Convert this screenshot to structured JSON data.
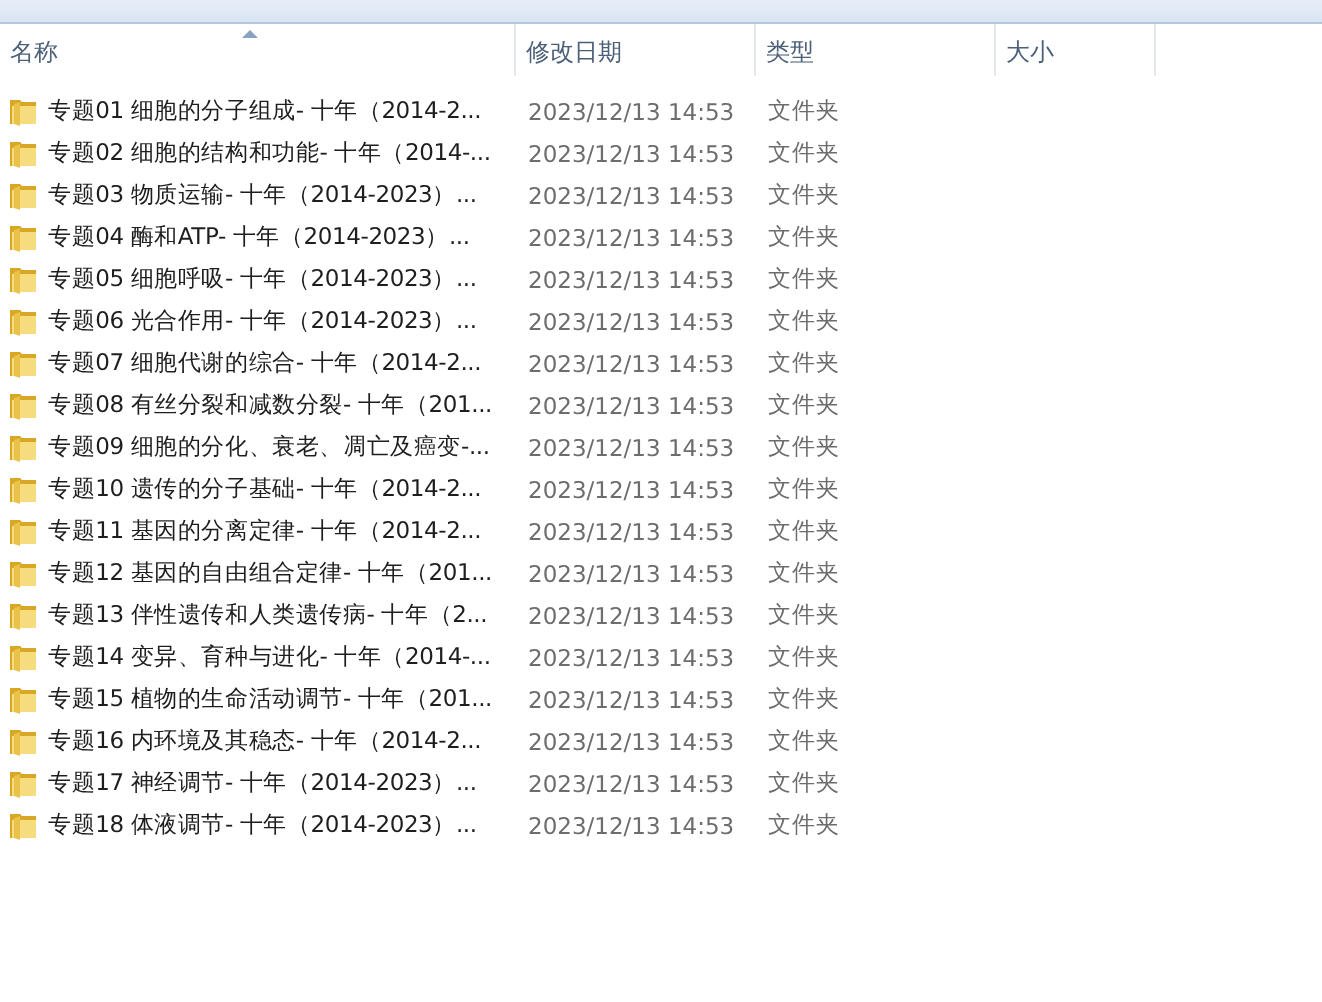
{
  "columns": [
    {
      "label": "名称",
      "sorted": true
    },
    {
      "label": "修改日期",
      "sorted": false
    },
    {
      "label": "类型",
      "sorted": false
    },
    {
      "label": "大小",
      "sorted": false
    }
  ],
  "rows": [
    {
      "name": "专题01 细胞的分子组成- 十年（2014-2...",
      "modified": "2023/12/13 14:53",
      "type": "文件夹"
    },
    {
      "name": "专题02 细胞的结构和功能- 十年（2014-...",
      "modified": "2023/12/13 14:53",
      "type": "文件夹"
    },
    {
      "name": "专题03 物质运输- 十年（2014-2023）...",
      "modified": "2023/12/13 14:53",
      "type": "文件夹"
    },
    {
      "name": "专题04 酶和ATP- 十年（2014-2023）...",
      "modified": "2023/12/13 14:53",
      "type": "文件夹"
    },
    {
      "name": "专题05 细胞呼吸- 十年（2014-2023）...",
      "modified": "2023/12/13 14:53",
      "type": "文件夹"
    },
    {
      "name": "专题06 光合作用- 十年（2014-2023）...",
      "modified": "2023/12/13 14:53",
      "type": "文件夹"
    },
    {
      "name": "专题07 细胞代谢的综合- 十年（2014-2...",
      "modified": "2023/12/13 14:53",
      "type": "文件夹"
    },
    {
      "name": "专题08 有丝分裂和减数分裂- 十年（201...",
      "modified": "2023/12/13 14:53",
      "type": "文件夹"
    },
    {
      "name": "专题09 细胞的分化、衰老、凋亡及癌变-...",
      "modified": "2023/12/13 14:53",
      "type": "文件夹"
    },
    {
      "name": "专题10 遗传的分子基础- 十年（2014-2...",
      "modified": "2023/12/13 14:53",
      "type": "文件夹"
    },
    {
      "name": "专题11 基因的分离定律- 十年（2014-2...",
      "modified": "2023/12/13 14:53",
      "type": "文件夹"
    },
    {
      "name": "专题12 基因的自由组合定律- 十年（201...",
      "modified": "2023/12/13 14:53",
      "type": "文件夹"
    },
    {
      "name": "专题13 伴性遗传和人类遗传病- 十年（2...",
      "modified": "2023/12/13 14:53",
      "type": "文件夹"
    },
    {
      "name": "专题14 变异、育种与进化- 十年（2014-...",
      "modified": "2023/12/13 14:53",
      "type": "文件夹"
    },
    {
      "name": "专题15 植物的生命活动调节- 十年（201...",
      "modified": "2023/12/13 14:53",
      "type": "文件夹"
    },
    {
      "name": "专题16 内环境及其稳态- 十年（2014-2...",
      "modified": "2023/12/13 14:53",
      "type": "文件夹"
    },
    {
      "name": "专题17 神经调节- 十年（2014-2023）...",
      "modified": "2023/12/13 14:53",
      "type": "文件夹"
    },
    {
      "name": "专题18 体液调节- 十年（2014-2023）...",
      "modified": "2023/12/13 14:53",
      "type": "文件夹"
    }
  ]
}
